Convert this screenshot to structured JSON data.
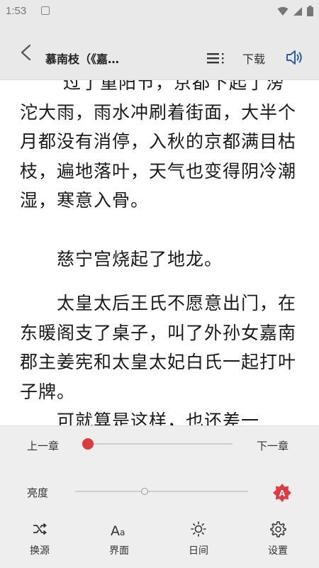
{
  "status_bar": {
    "time": "1:53"
  },
  "header": {
    "title": "慕南枝（《嘉…",
    "download_label": "下载"
  },
  "content": {
    "paragraphs": [
      "过了重阳节，京都下起了滂沱大雨，雨水冲刷着街面，大半个月都没有消停，入秋的京都满目枯枝，遍地落叶，天气也变得阴冷潮湿，寒意入骨。",
      "　　慈宁宫烧起了地龙。",
      "　　太皇太后王氏不愿意出门，在东暖阁支了桌子，叫了外孙女嘉南郡主姜宪和太皇太妃白氏一起打叶子牌。",
      "　　可就算是这样，也还差一"
    ]
  },
  "controls": {
    "prev_chapter": "上一章",
    "next_chapter": "下一章",
    "chapter_progress": 0,
    "brightness_label": "亮度",
    "brightness_level": 0.4,
    "auto_brightness_icon": "auto-brightness-icon",
    "accent_color": "#e0393e"
  },
  "bottom_nav": {
    "source": "换源",
    "interface": "界面",
    "day_night": "日间",
    "settings": "设置"
  }
}
